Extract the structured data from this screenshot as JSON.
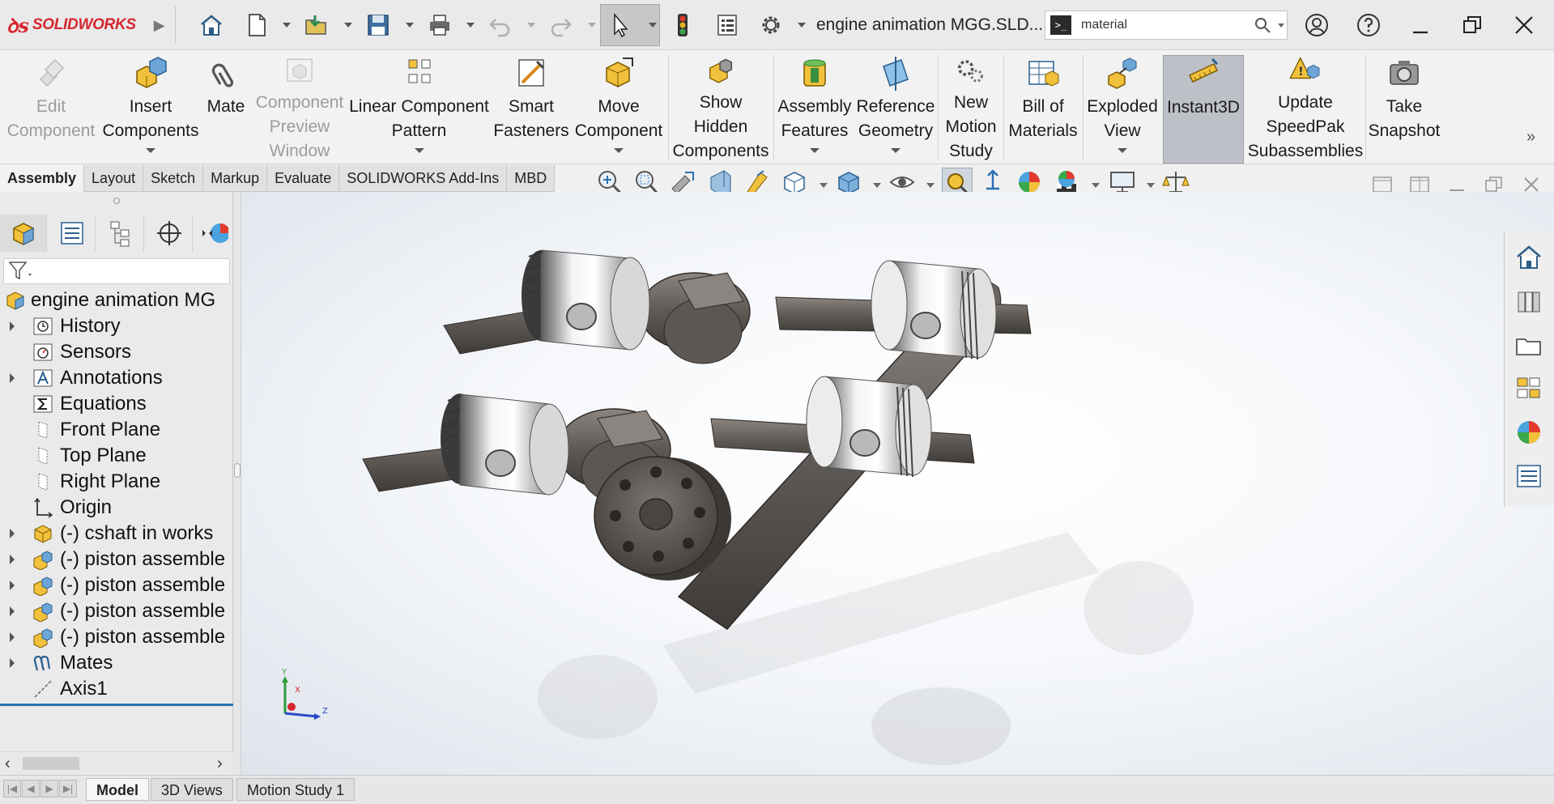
{
  "app": {
    "brand": "SOLIDWORKS",
    "document_title": "engine animation MGG.SLD...",
    "search_value": "material"
  },
  "quick_access": [
    "home-icon",
    "new-document-icon",
    "open-icon",
    "save-icon",
    "print-icon",
    "undo-icon",
    "redo-icon",
    "select-icon",
    "rebuild-traffic-light-icon",
    "file-properties-icon",
    "options-gear-icon"
  ],
  "ribbon": {
    "buttons": [
      {
        "id": "edit-component",
        "label": "Edit\nComponent",
        "disabled": true
      },
      {
        "id": "insert-components",
        "label": "Insert\nComponents",
        "dropdown": true
      },
      {
        "id": "mate",
        "label": "Mate"
      },
      {
        "id": "component-preview-window",
        "label": "Component\nPreview\nWindow",
        "disabled": true
      },
      {
        "id": "linear-component-pattern",
        "label": "Linear Component\nPattern",
        "dropdown": true
      },
      {
        "id": "smart-fasteners",
        "label": "Smart\nFasteners"
      },
      {
        "id": "move-component",
        "label": "Move\nComponent",
        "dropdown": true
      },
      {
        "id": "show-hidden-components",
        "label": "Show\nHidden\nComponents"
      },
      {
        "id": "assembly-features",
        "label": "Assembly\nFeatures",
        "dropdown": true
      },
      {
        "id": "reference-geometry",
        "label": "Reference\nGeometry",
        "dropdown": true
      },
      {
        "id": "new-motion-study",
        "label": "New\nMotion\nStudy"
      },
      {
        "id": "bill-of-materials",
        "label": "Bill of\nMaterials"
      },
      {
        "id": "exploded-view",
        "label": "Exploded\nView",
        "dropdown": true
      },
      {
        "id": "instant3d",
        "label": "Instant3D",
        "active": true
      },
      {
        "id": "update-speedpak",
        "label": "Update\nSpeedPak\nSubassemblies"
      },
      {
        "id": "take-snapshot",
        "label": "Take\nSnapshot"
      }
    ],
    "overflow_symbol": "»",
    "collapse_symbol": "︿"
  },
  "tabs": [
    "Assembly",
    "Layout",
    "Sketch",
    "Markup",
    "Evaluate",
    "SOLIDWORKS Add-Ins",
    "MBD"
  ],
  "tree": {
    "root": "engine animation MG",
    "items": [
      {
        "label": "History",
        "expandable": true,
        "icon": "history-icon"
      },
      {
        "label": "Sensors",
        "expandable": false,
        "icon": "sensors-icon"
      },
      {
        "label": "Annotations",
        "expandable": true,
        "icon": "annotations-icon"
      },
      {
        "label": "Equations",
        "expandable": false,
        "icon": "equations-icon"
      },
      {
        "label": "Front Plane",
        "expandable": false,
        "icon": "plane-icon"
      },
      {
        "label": "Top Plane",
        "expandable": false,
        "icon": "plane-icon"
      },
      {
        "label": "Right Plane",
        "expandable": false,
        "icon": "plane-icon"
      },
      {
        "label": "Origin",
        "expandable": false,
        "icon": "origin-icon"
      },
      {
        "label": "(-) cshaft in works",
        "expandable": true,
        "icon": "part-icon"
      },
      {
        "label": "(-) piston assemble",
        "expandable": true,
        "icon": "subassembly-icon"
      },
      {
        "label": "(-) piston assemble",
        "expandable": true,
        "icon": "subassembly-icon"
      },
      {
        "label": "(-) piston assemble",
        "expandable": true,
        "icon": "subassembly-icon"
      },
      {
        "label": "(-) piston assemble",
        "expandable": true,
        "icon": "subassembly-icon"
      },
      {
        "label": "Mates",
        "expandable": true,
        "icon": "mates-icon"
      },
      {
        "label": "Axis1",
        "expandable": false,
        "icon": "axis-icon"
      }
    ]
  },
  "bottom_tabs": [
    "Model",
    "3D Views",
    "Motion Study 1"
  ],
  "triad": {
    "y": "Y",
    "x": "X",
    "z": "Z"
  },
  "colors": {
    "brand_red": "#d7262e",
    "selection_blue": "#2b6fb3",
    "viewport_bg": "#f3f5f8"
  }
}
